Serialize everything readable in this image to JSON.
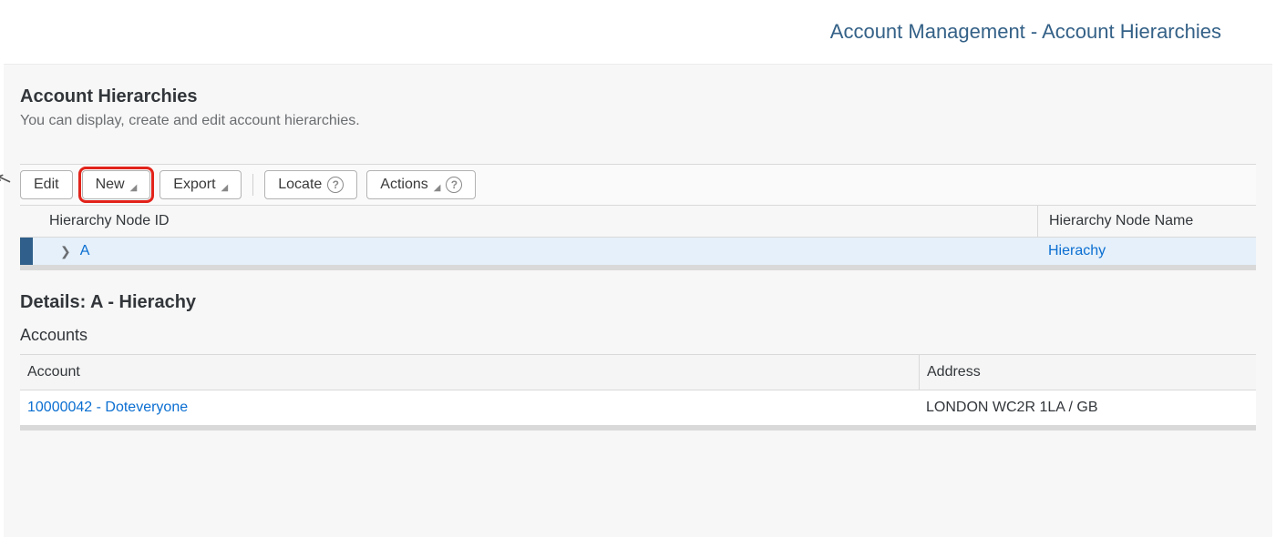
{
  "header": {
    "title": "Account Management - Account Hierarchies"
  },
  "section": {
    "title": "Account Hierarchies",
    "subtitle": "You can display, create and edit account hierarchies."
  },
  "toolbar": {
    "edit": "Edit",
    "new": "New",
    "export": "Export",
    "locate": "Locate",
    "actions": "Actions"
  },
  "tree": {
    "columns": {
      "id": "Hierarchy Node ID",
      "name": "Hierarchy Node Name"
    },
    "rows": [
      {
        "id": "A",
        "name": "Hierachy",
        "selected": true
      }
    ]
  },
  "details": {
    "title": "Details: A - Hierachy",
    "accounts_label": "Accounts",
    "columns": {
      "account": "Account",
      "address": "Address"
    },
    "rows": [
      {
        "account": "10000042 - Doteveryone",
        "address": "LONDON WC2R 1LA / GB"
      }
    ]
  }
}
